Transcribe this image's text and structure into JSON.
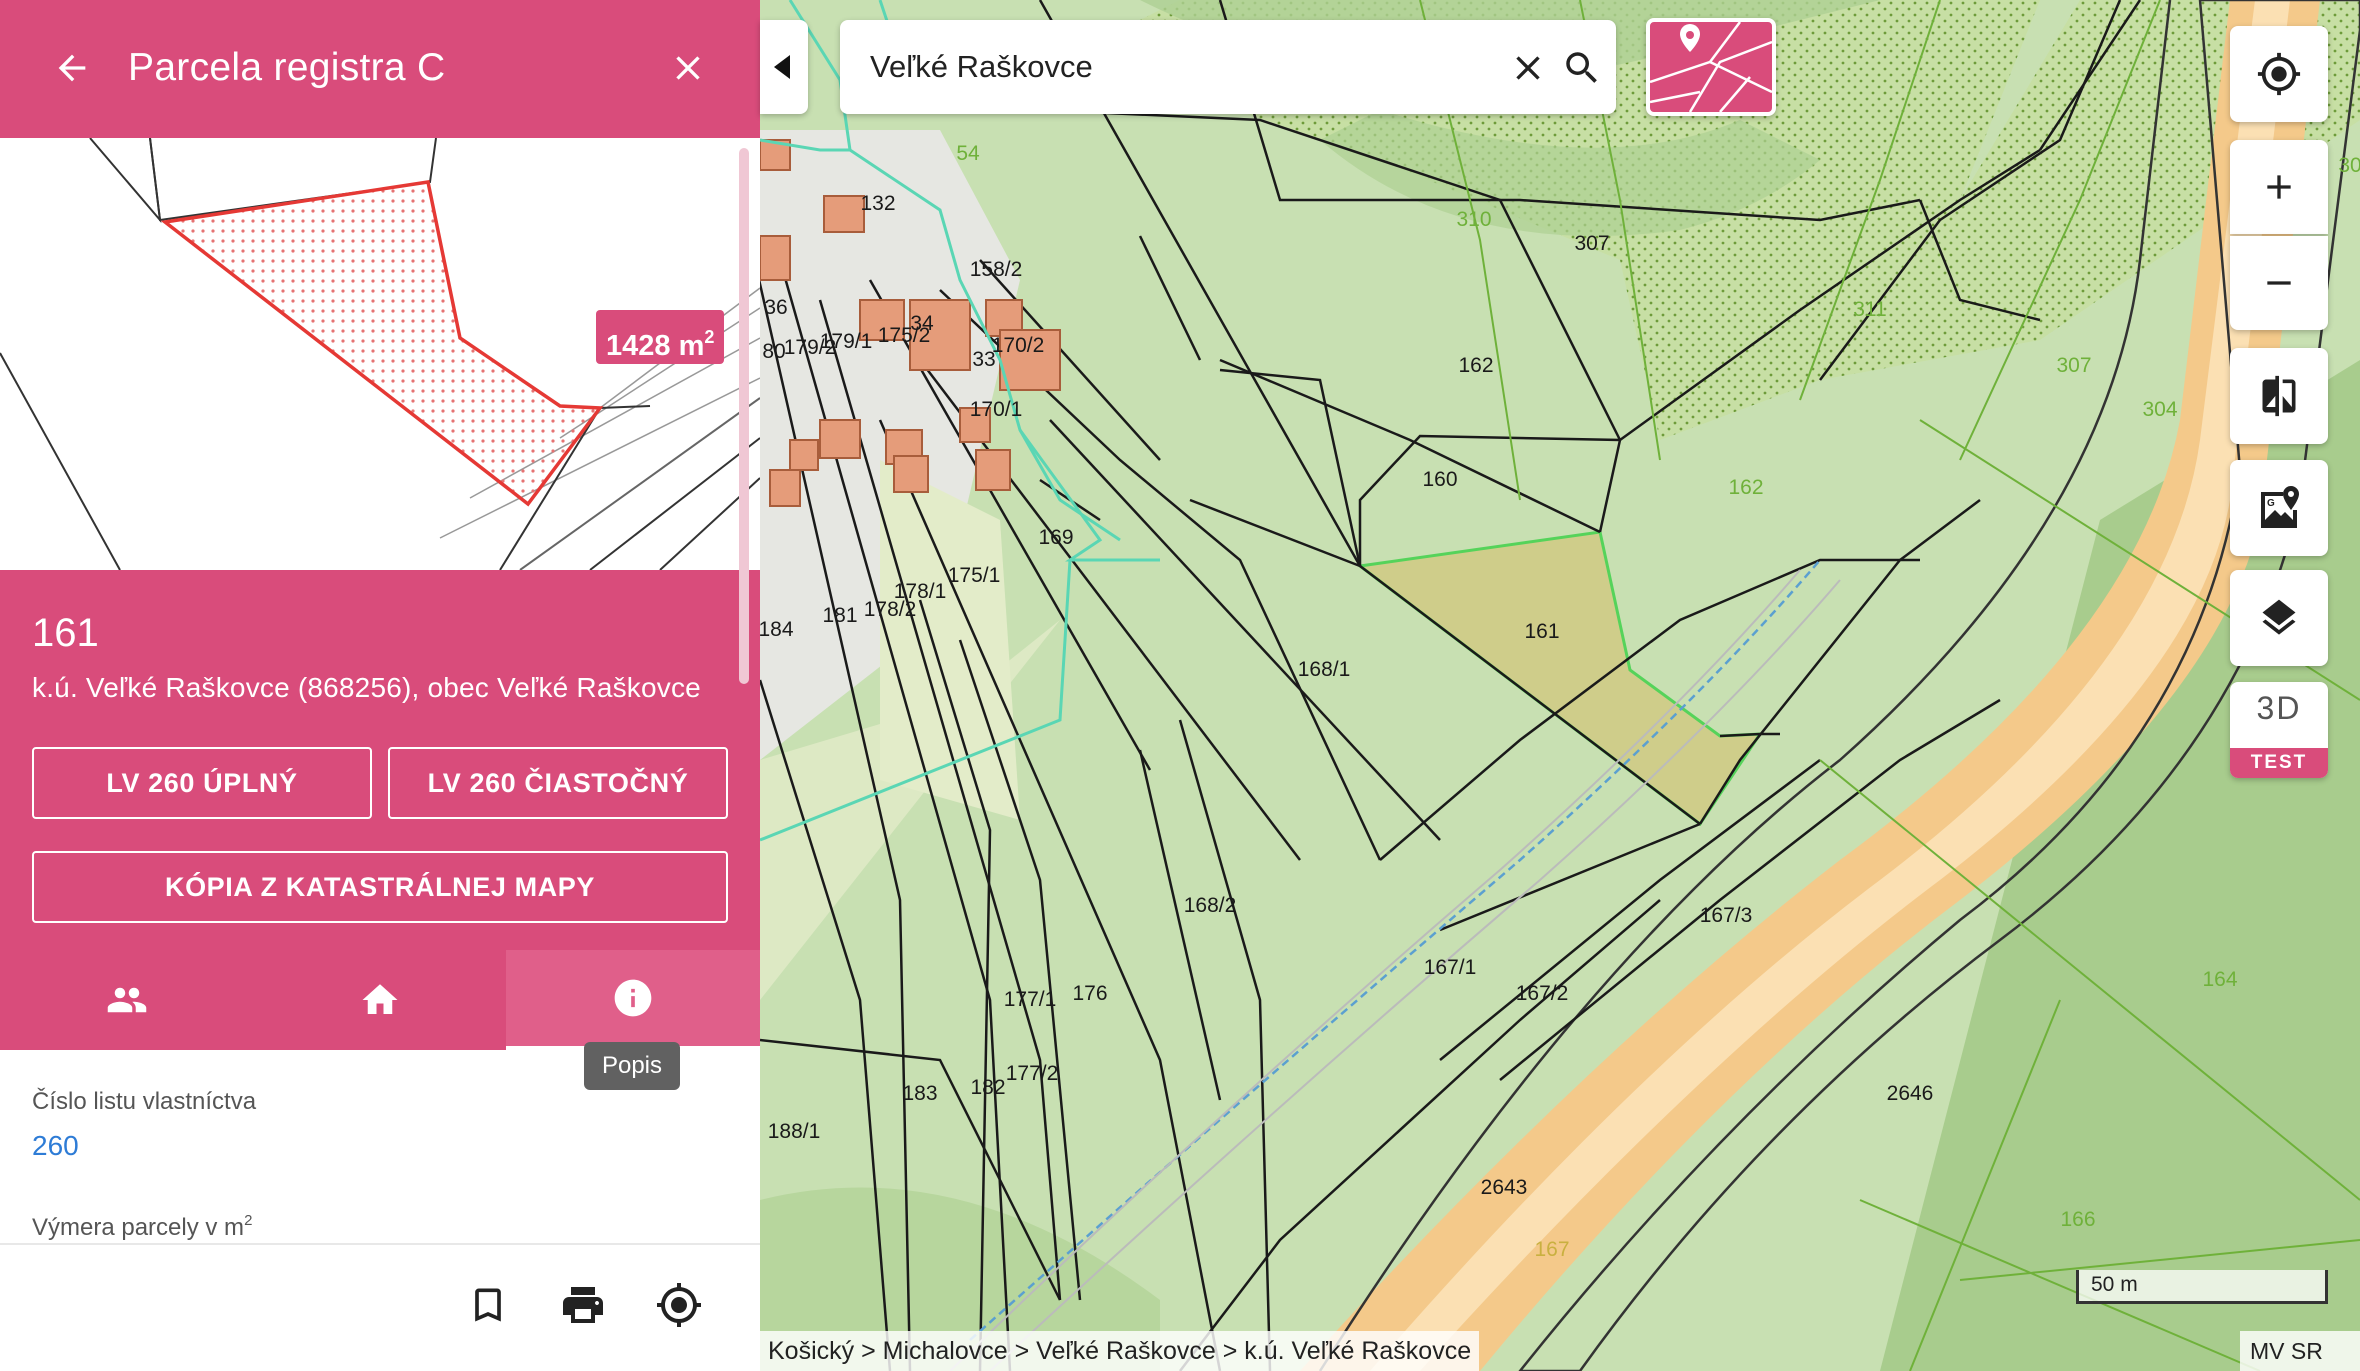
{
  "panel": {
    "title": "Parcela registra C",
    "area_badge_value": "1428 m",
    "area_badge_unit_sup": "2",
    "parcel_number": "161",
    "location": "k.ú. Veľké Raškovce (868256), obec Veľké Raškovce",
    "buttons": {
      "lv_full": "LV 260 ÚPLNÝ",
      "lv_partial": "LV 260 ČIASTOČNÝ",
      "copy_map": "KÓPIA Z KATASTRÁLNEJ MAPY"
    },
    "tabs": [
      {
        "name": "owners",
        "icon": "people-icon"
      },
      {
        "name": "building",
        "icon": "home-icon"
      },
      {
        "name": "description",
        "icon": "info-icon",
        "active": true
      }
    ],
    "tooltip": "Popis",
    "details": {
      "lv_label": "Číslo listu vlastníctva",
      "lv_value": "260",
      "area_label": "Výmera parcely v m",
      "area_label_sup": "2"
    },
    "bottom_actions": [
      "bookmark-icon",
      "print-icon",
      "gps-target-icon"
    ]
  },
  "search": {
    "value": "Veľké Raškovce",
    "placeholder": ""
  },
  "map": {
    "parcel_labels": [
      "54",
      "132",
      "158/2",
      "36",
      "179/2",
      "179/1",
      "175/2",
      "34",
      "170/2",
      "33",
      "80",
      "170/1",
      "169",
      "175/1",
      "184",
      "181",
      "178/2",
      "178/1",
      "168/1",
      "161",
      "160",
      "162",
      "307",
      "310",
      "311",
      "307",
      "304",
      "162",
      "168/2",
      "167/1",
      "167/2",
      "167/3",
      "176",
      "177/1",
      "177/2",
      "183",
      "182",
      "188/1",
      "2646",
      "2643",
      "164",
      "166",
      "167",
      "30"
    ],
    "highlighted_parcel": "161",
    "scale": "50 m",
    "breadcrumb": "Košický > Michalovce > Veľké Raškovce > k.ú. Veľké Raškovce",
    "attribution": "MV SR",
    "controls": {
      "three_d": "3D",
      "three_d_badge": "TEST"
    }
  },
  "colors": {
    "accent": "#d94c7b",
    "link": "#2e7cd6",
    "map_green": "#c9e0b4",
    "road": "#f5c98a",
    "highlight_fill": "#cfcf8a"
  }
}
